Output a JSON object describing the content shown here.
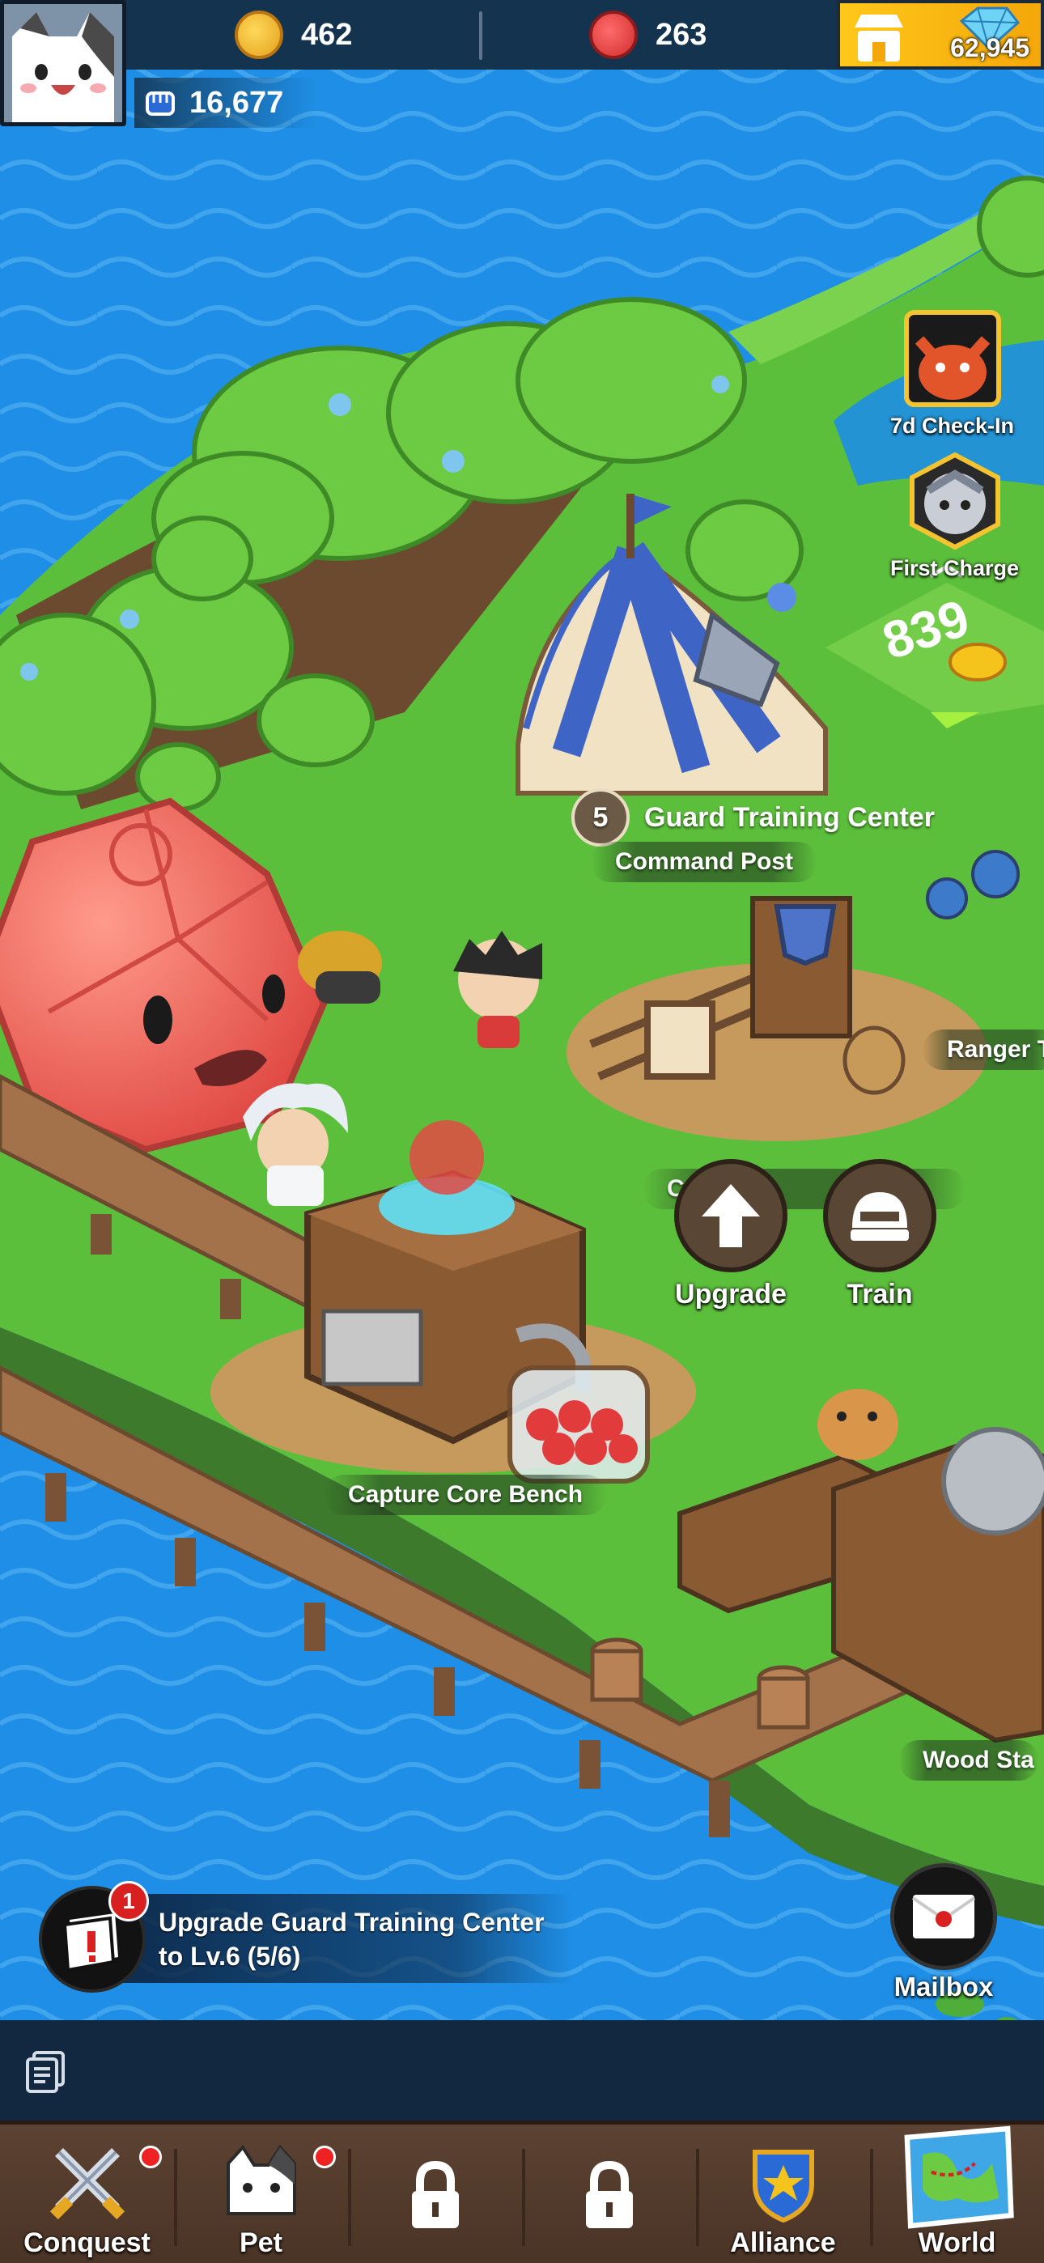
{
  "top_bar": {
    "coins": "462",
    "red_orbs": "263",
    "gems": "62,945",
    "power": "16,677"
  },
  "events": [
    {
      "label": "7d Check-In",
      "icon": "dragon-icon"
    },
    {
      "label": "First Charge",
      "icon": "cat-helmet-icon"
    }
  ],
  "map": {
    "floating_reward": "839",
    "guard_level": "5",
    "guard_name": "Guard Training Center",
    "command_post": "Command Post",
    "ranger": "Ranger T",
    "training_hidden": "C        ainin       r",
    "capture_bench": "Capture Core Bench",
    "wood_station": "Wood Sta"
  },
  "actions": {
    "upgrade": "Upgrade",
    "train": "Train"
  },
  "quest": {
    "badge": "1",
    "line1": "Upgrade Guard Training Center",
    "line2": "to Lv.6 (5/6)"
  },
  "mailbox": {
    "label": "Mailbox"
  },
  "nav": [
    {
      "label": "Conquest",
      "icon": "crossed-swords-icon",
      "dot": true
    },
    {
      "label": "Pet",
      "icon": "cat-face-icon",
      "dot": true
    },
    {
      "label": "",
      "icon": "lock-icon",
      "dot": false
    },
    {
      "label": "",
      "icon": "lock-icon",
      "dot": false
    },
    {
      "label": "Alliance",
      "icon": "alliance-shield-icon",
      "dot": false
    },
    {
      "label": "World",
      "icon": "world-map-icon",
      "dot": false
    }
  ],
  "colors": {
    "water": "#1e8ee6",
    "grass": "#5cbf3b",
    "topbar": "#14334f",
    "nav": "#5c4232"
  }
}
